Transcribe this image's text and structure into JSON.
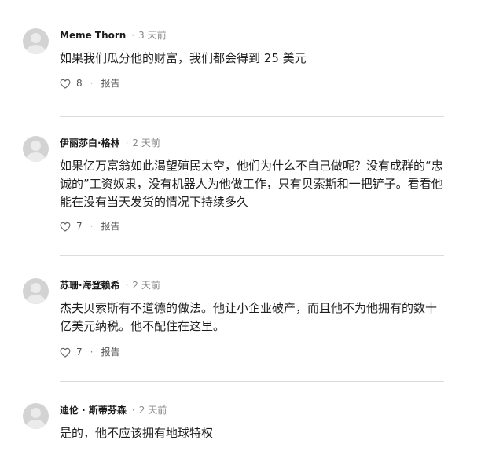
{
  "comments": [
    {
      "author": "Meme Thorn",
      "time": "3 天前",
      "text": "如果我们瓜分他的财富，我们都会得到 25 美元",
      "likes": "8",
      "report": "报告"
    },
    {
      "author": "伊丽莎白·格林",
      "time": "2 天前",
      "text": "如果亿万富翁如此渴望殖民太空，他们为什么不自己做呢？没有成群的“忠诚的”工资奴隶，没有机器人为他做工作，只有贝索斯和一把铲子。看看他能在没有当天发货的情况下持续多久",
      "likes": "7",
      "report": "报告"
    },
    {
      "author": "苏珊·海登赖希",
      "time": "2 天前",
      "text": "杰夫贝索斯有不道德的做法。他让小企业破产，而且他不为他拥有的数十亿美元纳税。他不配住在这里。",
      "likes": "7",
      "report": "报告"
    },
    {
      "author": "迪伦 · 斯蒂芬森",
      "time": "2 天前",
      "text": "是的，他不应该拥有地球特权"
    }
  ],
  "separator_dot": "·"
}
